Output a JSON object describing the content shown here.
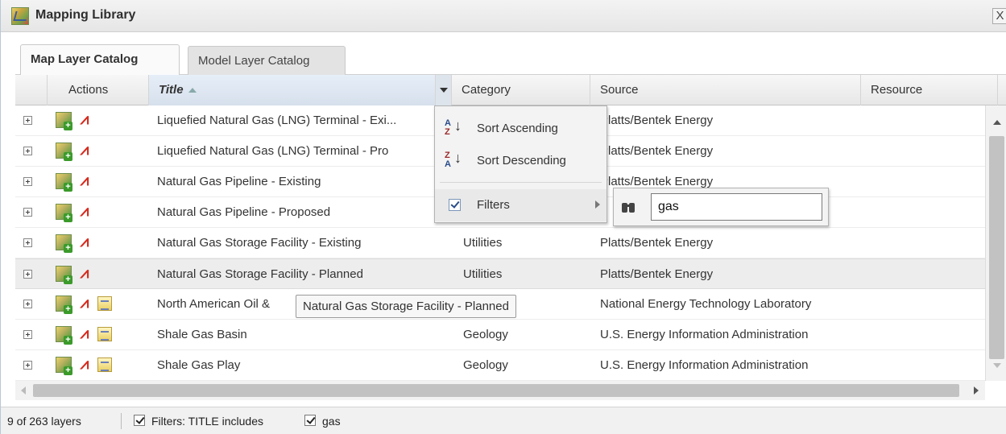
{
  "window": {
    "title": "Mapping Library",
    "close_label": "X",
    "icon": "map-catalog-icon"
  },
  "tabs": [
    {
      "label": "Map Layer Catalog",
      "active": true
    },
    {
      "label": "Model Layer Catalog",
      "active": false
    }
  ],
  "grid": {
    "columns": {
      "actions": "Actions",
      "title": "Title",
      "category": "Category",
      "source": "Source",
      "resource": "Resource"
    },
    "sort": {
      "column": "Title",
      "direction": "ascending"
    },
    "rows": [
      {
        "title": "Liquefied Natural Gas (LNG) Terminal - Exi...",
        "category": "",
        "source": "Platts/Bentek Energy",
        "icons": [
          "add-map-icon",
          "pdf-icon"
        ]
      },
      {
        "title": "Liquefied Natural Gas (LNG) Terminal - Pro",
        "category": "",
        "source": "Platts/Bentek Energy",
        "icons": [
          "add-map-icon",
          "pdf-icon"
        ]
      },
      {
        "title": "Natural Gas Pipeline - Existing",
        "category": "",
        "source": "Platts/Bentek Energy",
        "icons": [
          "add-map-icon",
          "pdf-icon"
        ]
      },
      {
        "title": "Natural Gas Pipeline - Proposed",
        "category": "",
        "source": "",
        "icons": [
          "add-map-icon",
          "pdf-icon"
        ]
      },
      {
        "title": "Natural Gas Storage Facility - Existing",
        "category": "Utilities",
        "source": "Platts/Bentek Energy",
        "icons": [
          "add-map-icon",
          "pdf-icon"
        ]
      },
      {
        "title": "Natural Gas Storage Facility - Planned",
        "category": "Utilities",
        "source": "Platts/Bentek Energy",
        "icons": [
          "add-map-icon",
          "pdf-icon"
        ]
      },
      {
        "title": "North American Oil &",
        "category": "",
        "source": "National Energy Technology Laboratory",
        "icons": [
          "add-map-icon",
          "pdf-icon",
          "metadata-icon"
        ]
      },
      {
        "title": "Shale Gas Basin",
        "category": "Geology",
        "source": "U.S. Energy Information Administration",
        "icons": [
          "add-map-icon",
          "pdf-icon",
          "metadata-icon"
        ]
      },
      {
        "title": "Shale Gas Play",
        "category": "Geology",
        "source": "U.S. Energy Information Administration",
        "icons": [
          "add-map-icon",
          "pdf-icon",
          "metadata-icon"
        ]
      }
    ],
    "hovered_row_index": 5
  },
  "tooltip": {
    "text": "Natural Gas Storage Facility - Planned"
  },
  "column_menu": {
    "sort_ascending": "Sort Ascending",
    "sort_descending": "Sort Descending",
    "filters": "Filters",
    "filters_checked": true
  },
  "filter_submenu": {
    "value": "gas",
    "icon": "binoculars-icon"
  },
  "status": {
    "count": "9 of 263 layers",
    "filter_label": "Filters: TITLE includes",
    "filter_value": "gas"
  }
}
